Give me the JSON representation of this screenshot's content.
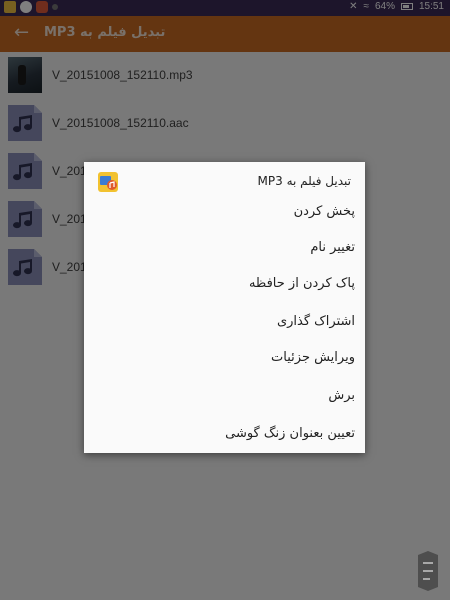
{
  "status_bar": {
    "battery": "64%",
    "time": "15:51"
  },
  "app_bar": {
    "title": "تبدیل فیلم به MP3",
    "back_icon": "arrow-back-icon"
  },
  "files": [
    {
      "name": "V_20151008_152110.mp3",
      "icon": "video-thumbnail"
    },
    {
      "name": "V_20151008_152110.aac",
      "icon": "music-file-icon"
    },
    {
      "name": "V_20151008_152110",
      "icon": "music-file-icon"
    },
    {
      "name": "V_20151008_152110",
      "icon": "music-file-icon"
    },
    {
      "name": "V_20151008_152110",
      "icon": "music-file-icon"
    }
  ],
  "dialog": {
    "title": "تبدیل فیلم به MP3",
    "app_icon": "app-logo-icon",
    "items": [
      "پخش کردن",
      "تغییر نام",
      "پاک کردن از حافظه",
      "اشتراک گذاری",
      "ویرایش جزئیات",
      "برش",
      "تعیین بعنوان زنگ گوشی"
    ]
  },
  "colors": {
    "status_bar": "#3a2a56",
    "app_bar": "#c96a23",
    "file_icon": "#8a8fb8",
    "dialog_bg": "#fafafa"
  }
}
